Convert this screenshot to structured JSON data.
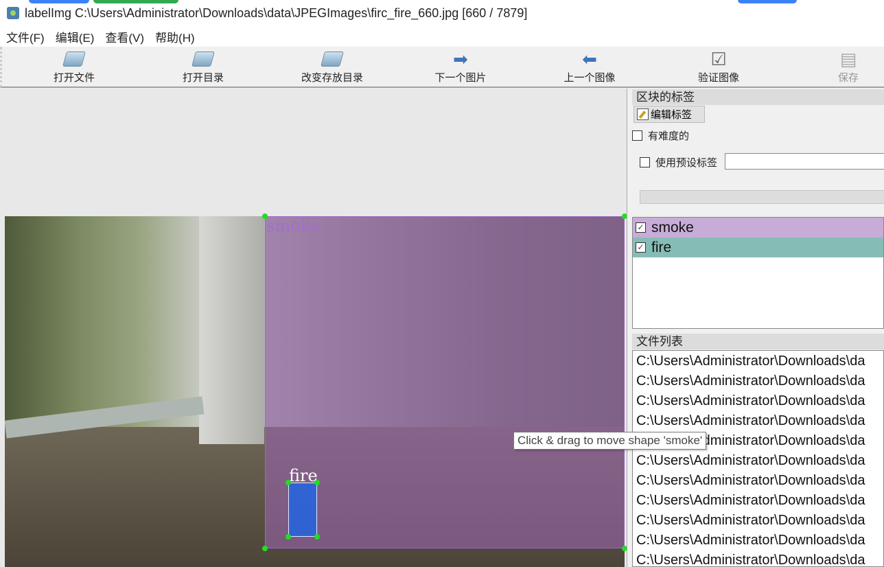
{
  "window": {
    "title": "labelImg C:\\Users\\Administrator\\Downloads\\data\\JPEGImages\\firc_fire_660.jpg [660 / 7879]"
  },
  "menu": [
    "文件(F)",
    "编辑(E)",
    "查看(V)",
    "帮助(H)"
  ],
  "toolbar": {
    "open_file": "打开文件",
    "open_dir": "打开目录",
    "change_save_dir": "改变存放目录",
    "next_image": "下一个图片",
    "prev_image": "上一个图像",
    "verify": "验证图像",
    "save": "保存"
  },
  "canvas": {
    "shapes": [
      {
        "label": "smoke",
        "color": "#9b66c4"
      },
      {
        "label": "fire",
        "color": "#1e64e6"
      }
    ],
    "tooltip": "Click & drag to move shape 'smoke'"
  },
  "labels_dock": {
    "title": "区块的标签",
    "edit_label": "编辑标签",
    "difficult": "有难度的",
    "use_default": "使用预设标签",
    "default_value": "",
    "items": [
      {
        "label": "smoke",
        "checked": true,
        "color": "#c8acd8"
      },
      {
        "label": "fire",
        "checked": true,
        "color": "#86bcb6"
      }
    ]
  },
  "files_dock": {
    "title": "文件列表",
    "items": [
      "C:\\Users\\Administrator\\Downloads\\da",
      "C:\\Users\\Administrator\\Downloads\\da",
      "C:\\Users\\Administrator\\Downloads\\da",
      "C:\\Users\\Administrator\\Downloads\\da",
      "C:\\Users\\Administrator\\Downloads\\da",
      "C:\\Users\\Administrator\\Downloads\\da",
      "C:\\Users\\Administrator\\Downloads\\da",
      "C:\\Users\\Administrator\\Downloads\\da",
      "C:\\Users\\Administrator\\Downloads\\da",
      "C:\\Users\\Administrator\\Downloads\\da",
      "C:\\Users\\Administrator\\Downloads\\da"
    ]
  }
}
